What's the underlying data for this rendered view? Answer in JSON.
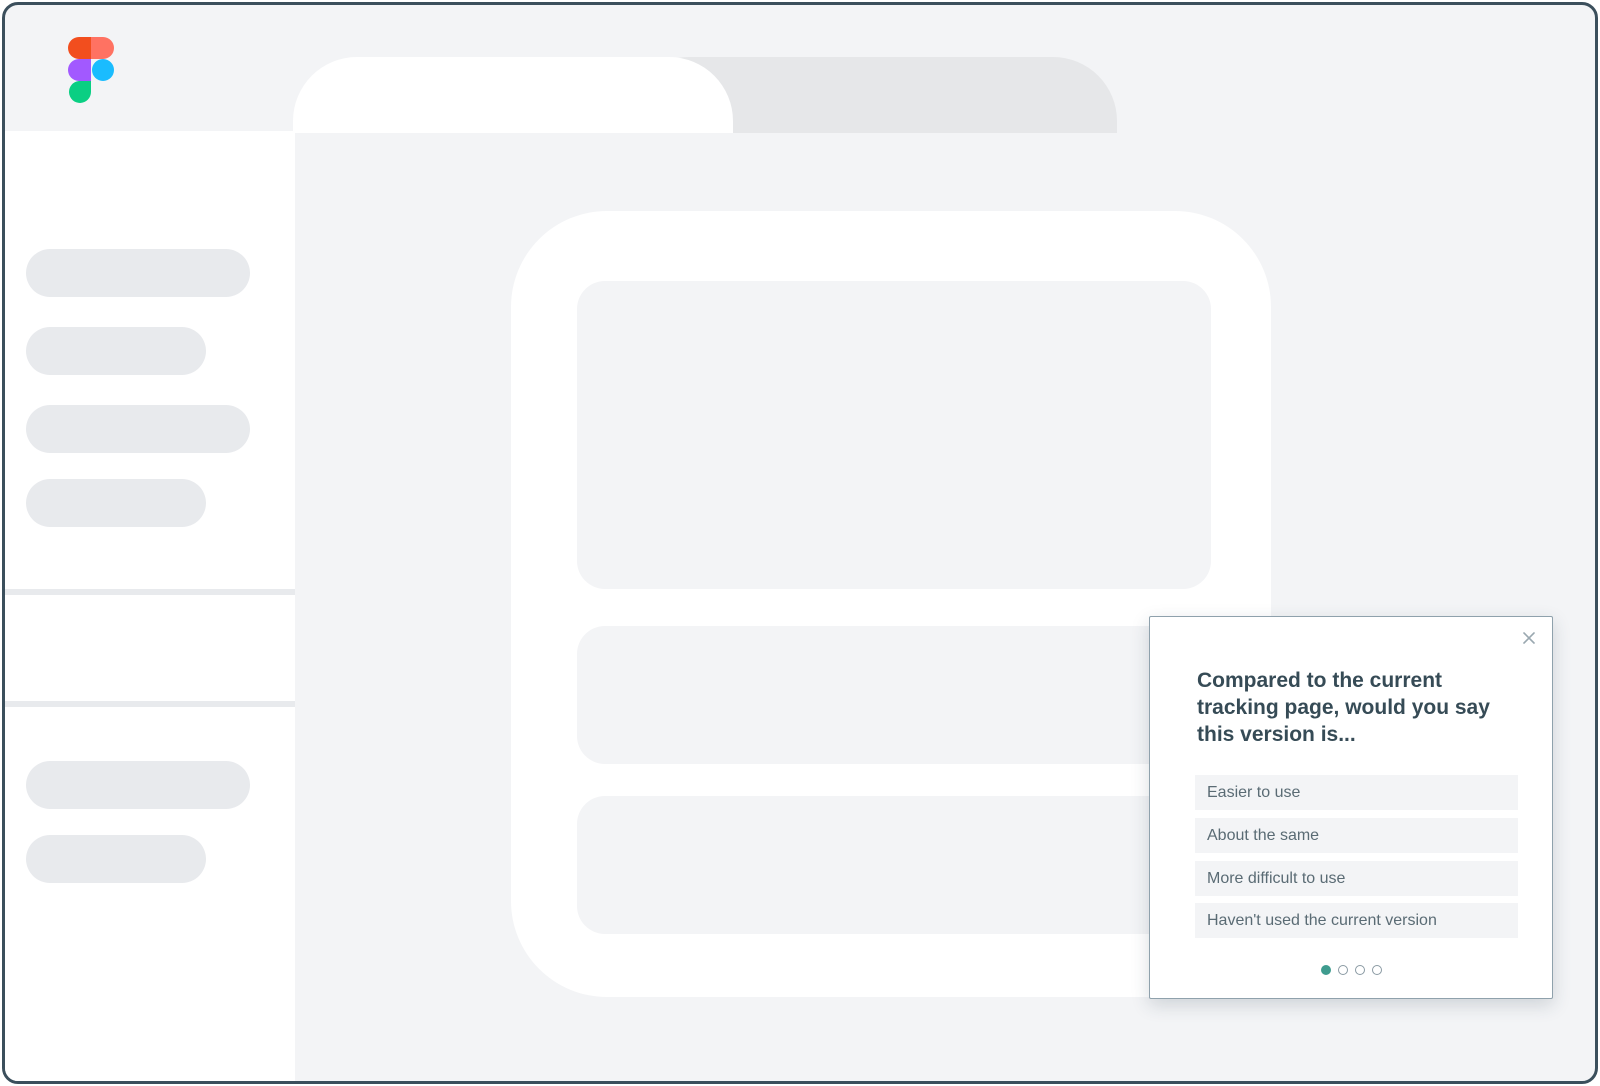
{
  "app": {
    "logo_icon": "figma-logo-icon"
  },
  "colors": {
    "frame_border": "#3b4f5c",
    "background": "#f3f4f6",
    "placeholder": "#e8eaed",
    "text_dark": "#364b56",
    "accent": "#3f9c8f"
  },
  "survey": {
    "question": "Compared to the current tracking page, would you say this version is...",
    "close_icon": "close-icon",
    "options": [
      {
        "label": "Easier to use"
      },
      {
        "label": "About the same"
      },
      {
        "label": "More difficult to use"
      },
      {
        "label": "Haven't used the current version"
      }
    ],
    "pagination": {
      "current_page": 1,
      "total_pages": 4
    }
  }
}
